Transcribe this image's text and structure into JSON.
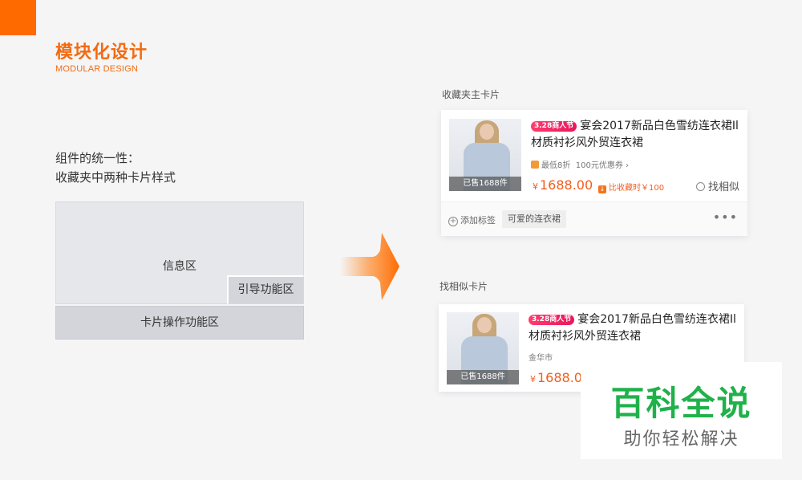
{
  "header": {
    "title": "模块化设计",
    "subtitle": "MODULAR DESIGN",
    "accent_color": "#ff6a00"
  },
  "description": {
    "line1": "组件的统一性：",
    "line2": "收藏夹中两种卡片样式"
  },
  "diagram": {
    "info_area": "信息区",
    "guide_area": "引导功能区",
    "action_area": "卡片操作功能区"
  },
  "card_main": {
    "section_label": "收藏夹主卡片",
    "badge": "3.28商人节",
    "title_line1": "宴会2017新品白色雪纺连衣裙Il",
    "title_line2": "材质衬衫风外贸连衣裙",
    "discount_text": "最低8折",
    "coupon_text": "100元优惠券",
    "coupon_arrow": "›",
    "sold": "已售1688件",
    "price_symbol": "¥",
    "price": "1688.00",
    "drop_icon": "↓",
    "drop_text": "比收藏时￥100",
    "similar_button": "找相似",
    "add_tag": "添加标签",
    "tag_chip": "可爱的连衣裙",
    "more_icon": "•••"
  },
  "card_similar": {
    "section_label": "找相似卡片",
    "badge": "3.28商人节",
    "title_line1": "宴会2017新品白色雪纺连衣裙Il",
    "title_line2": "材质衬衫风外贸连衣裙",
    "location": "金华市",
    "sold": "已售1688件",
    "price_symbol": "¥",
    "price": "1688.0"
  },
  "watermark": {
    "main": "百科全说",
    "sub": "助你轻松解决"
  },
  "colors": {
    "brand_orange": "#f46a10",
    "price_orange": "#f45c1c",
    "badge_pink": "#e8175d",
    "watermark_green": "#20b14b"
  }
}
